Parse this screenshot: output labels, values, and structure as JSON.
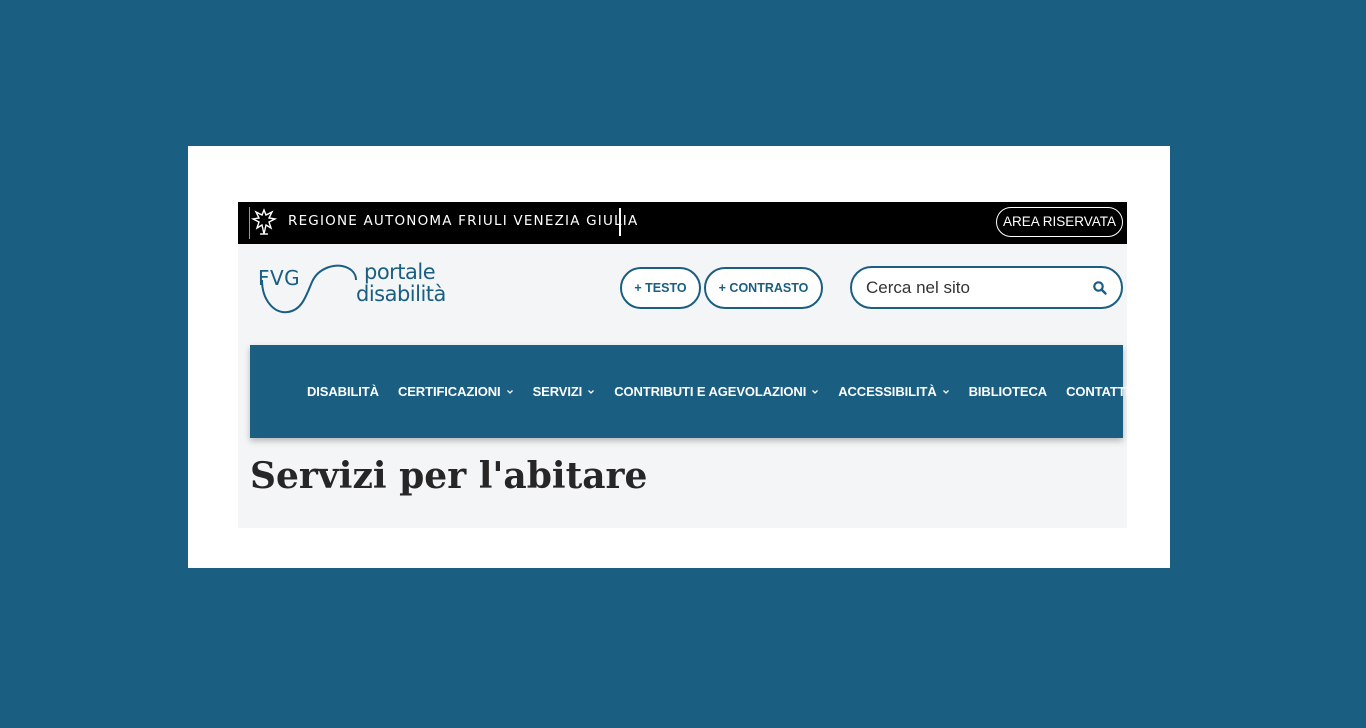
{
  "topbar": {
    "region_name": "REGIONE AUTONOMA FRIULI VENEZIA GIULIA",
    "reserved_area_label": "AREA RISERVATA",
    "emblem_icon": "region-eagle-emblem"
  },
  "header": {
    "logo": {
      "fvg": "FVG",
      "portale": "portale",
      "disabilita": "disabilità"
    },
    "text_size_label": "+ TESTO",
    "contrast_label": "+ CONTRASTO",
    "search": {
      "placeholder": "Cerca nel sito",
      "icon": "search-icon"
    }
  },
  "nav": {
    "items": [
      {
        "label": "DISABILITÀ",
        "has_dropdown": false
      },
      {
        "label": "CERTIFICAZIONI",
        "has_dropdown": true
      },
      {
        "label": "SERVIZI",
        "has_dropdown": true
      },
      {
        "label": "CONTRIBUTI E AGEVOLAZIONI",
        "has_dropdown": true
      },
      {
        "label": "ACCESSIBILITÀ",
        "has_dropdown": true
      },
      {
        "label": "BIBLIOTECA",
        "has_dropdown": false
      },
      {
        "label": "CONTATTI",
        "has_dropdown": false
      }
    ]
  },
  "main": {
    "page_title": "Servizi per l'abitare"
  },
  "colors": {
    "background": "#1a5e82",
    "brand_blue": "#1a5e82",
    "topbar": "#000000",
    "site_bg": "#f4f5f7",
    "title_text": "#262626"
  }
}
